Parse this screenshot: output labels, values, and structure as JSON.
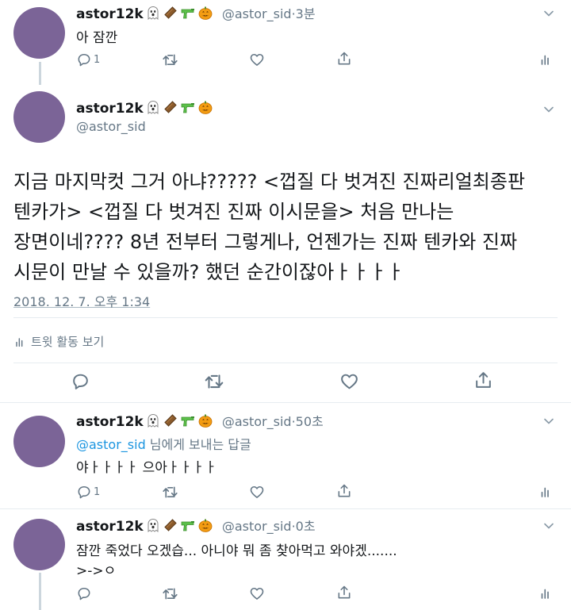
{
  "tweets": [
    {
      "name": "astor12k",
      "handle": "@astor_sid",
      "time": "·3분",
      "text": "아 잠깐",
      "reply_count": "1"
    },
    {
      "name": "astor12k",
      "handle": "@astor_sid",
      "time": "·50초",
      "reply_to_handle": "@astor_sid",
      "reply_to_suffix": " 님에게 보내는 답글",
      "text": "야ㅏㅏㅏㅏ 으아ㅏㅏㅏㅏ",
      "reply_count": "1"
    },
    {
      "name": "astor12k",
      "handle": "@astor_sid",
      "time": "·0초",
      "text": "잠깐 죽었다 오겠습... 아니야 뭐 좀 찾아먹고 와야겠.......",
      "text2": ">->ㅇ",
      "reply_count": ""
    }
  ],
  "main_tweet": {
    "name": "astor12k",
    "handle": "@astor_sid",
    "lines": [
      "지금 마지막컷 그거 아냐????? <껍질 다 벗겨진 진짜리얼최종판",
      "텐카가> <껍질 다 벗겨진 진짜 이시문을> 처음 만나는",
      "장면이네???? 8년 전부터 그렇게나, 언젠가는 진짜 텐카와 진짜",
      "시문이 만날 수 있을까? 했던 순간이잖아ㅏㅏㅏㅏ"
    ],
    "date": "2018. 12. 7. 오후 1:34",
    "activity_label": "트윗 활동 보기"
  },
  "icons": [
    "ghost-emoji",
    "coffin-emoji",
    "water-pistol-emoji",
    "jack-o-lantern-emoji",
    "chevron-down-icon",
    "reply-icon",
    "retweet-icon",
    "like-icon",
    "share-icon",
    "analytics-icon"
  ],
  "colors": {
    "avatar": "#7b6497",
    "muted": "#657786",
    "link": "#1b95e0",
    "divider": "#e6ecf0"
  }
}
